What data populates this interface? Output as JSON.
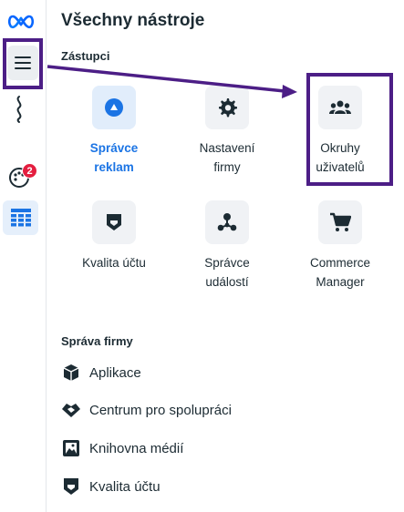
{
  "header": {
    "title": "Všechny nástroje"
  },
  "rail": {
    "notification_count": "2"
  },
  "sections": {
    "zastupci": {
      "label": "Zástupci",
      "tiles": [
        {
          "label_line1": "Správce",
          "label_line2": "reklam",
          "icon": "ads-manager-icon",
          "active": true
        },
        {
          "label_line1": "Nastavení",
          "label_line2": "firmy",
          "icon": "gear-icon",
          "active": false
        },
        {
          "label_line1": "Okruhy",
          "label_line2": "uživatelů",
          "icon": "audiences-icon",
          "active": false
        },
        {
          "label_line1": "Kvalita účtu",
          "label_line2": "",
          "icon": "shield-icon",
          "active": false
        },
        {
          "label_line1": "Správce",
          "label_line2": "událostí",
          "icon": "events-manager-icon",
          "active": false
        },
        {
          "label_line1": "Commerce",
          "label_line2": "Manager",
          "icon": "cart-icon",
          "active": false
        }
      ]
    },
    "sprava_firmy": {
      "label": "Správa firmy",
      "items": [
        {
          "label": "Aplikace",
          "icon": "cube-icon"
        },
        {
          "label": "Centrum pro spolupráci",
          "icon": "handshake-icon"
        },
        {
          "label": "Knihovna médií",
          "icon": "media-library-icon"
        },
        {
          "label": "Kvalita účtu",
          "icon": "shield-icon"
        }
      ]
    }
  },
  "colors": {
    "accent": "#1b74e4",
    "highlight": "#4c1e86",
    "badge": "#e41e3f",
    "text": "#1c2b33"
  }
}
